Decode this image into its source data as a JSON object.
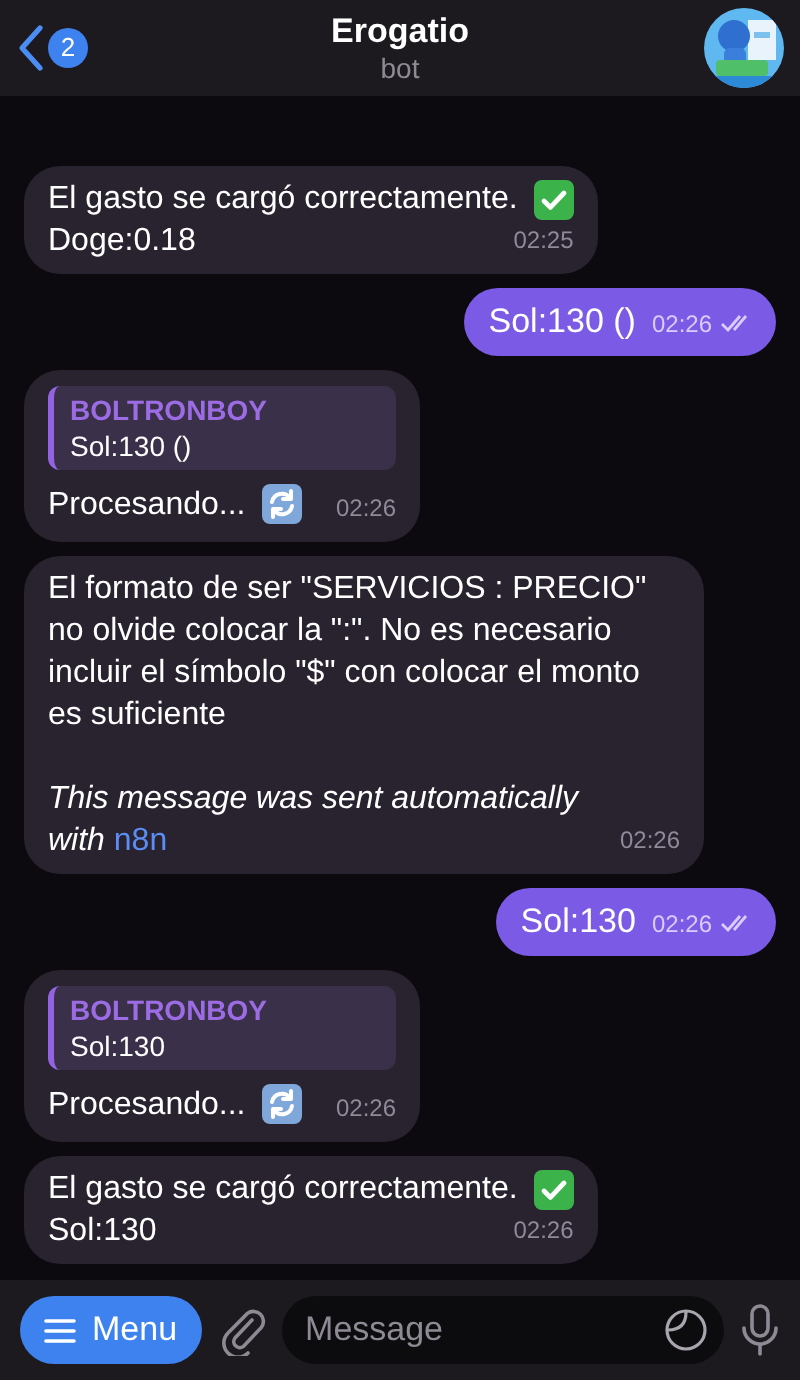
{
  "header": {
    "back_badge": "2",
    "title": "Erogatio",
    "subtitle": "bot"
  },
  "messages": [
    {
      "kind": "success",
      "lines": [
        "El gasto se cargó correctamente.",
        "Doge:0.18"
      ],
      "time": "02:25"
    },
    {
      "kind": "outgoing",
      "text": "Sol:130 ()",
      "time": "02:26",
      "read": true
    },
    {
      "kind": "processing",
      "reply": {
        "author": "BOLTRONBOY",
        "text": "Sol:130 ()"
      },
      "text": "Procesando...",
      "time": "02:26"
    },
    {
      "kind": "text",
      "text": "El formato de ser \"SERVICIOS : PRECIO\" no olvide colocar la \":\". No es necesario incluir el símbolo \"$\" con colocar el monto es suficiente",
      "footer": "This message was sent automatically with",
      "link": "n8n",
      "time": "02:26"
    },
    {
      "kind": "outgoing",
      "text": "Sol:130",
      "time": "02:26",
      "read": true
    },
    {
      "kind": "processing",
      "reply": {
        "author": "BOLTRONBOY",
        "text": "Sol:130"
      },
      "text": "Procesando...",
      "time": "02:26"
    },
    {
      "kind": "success",
      "lines": [
        "El gasto se cargó correctamente.",
        "Sol:130"
      ],
      "time": "02:26"
    }
  ],
  "composer": {
    "menu_label": "Menu",
    "placeholder": "Message"
  }
}
